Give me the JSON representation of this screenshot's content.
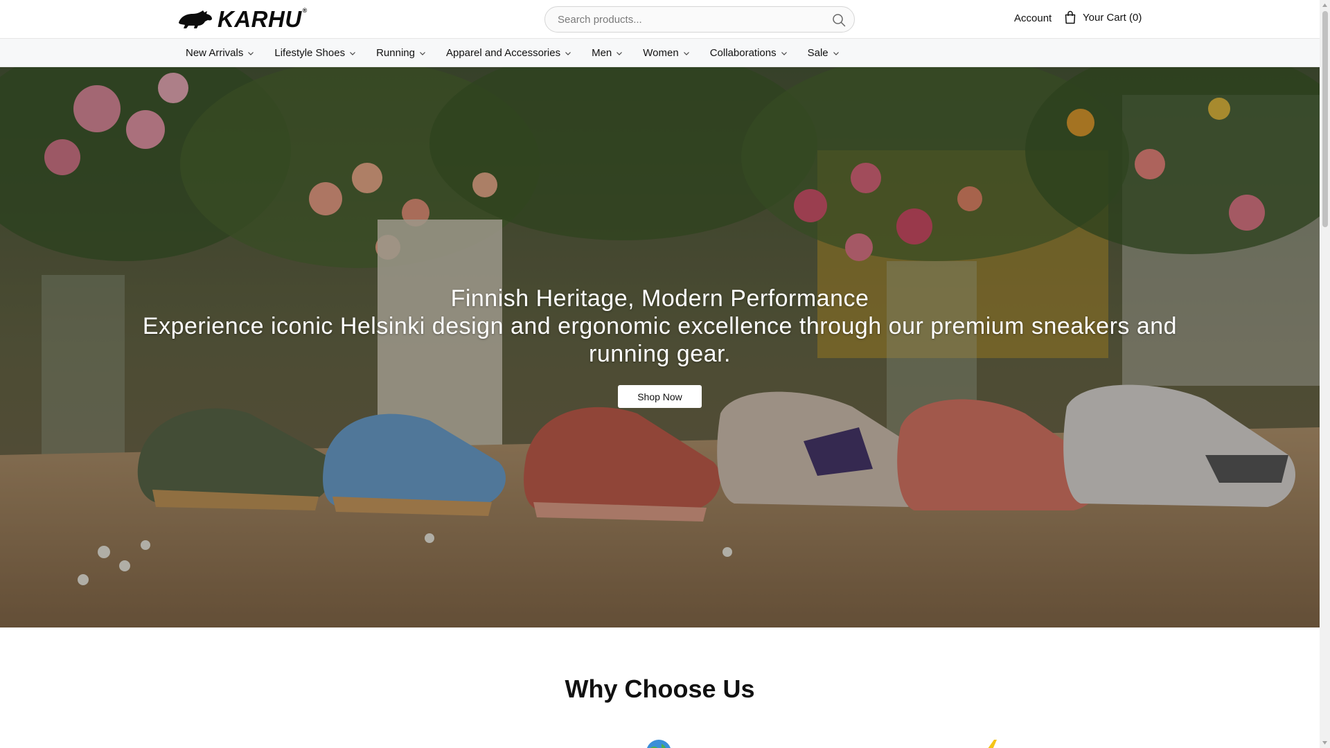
{
  "header": {
    "logo_text": "KARHU",
    "logo_reg": "®",
    "search_placeholder": "Search products...",
    "account_label": "Account",
    "cart_label": "Your Cart (0)"
  },
  "nav": {
    "items": [
      {
        "label": "New Arrivals"
      },
      {
        "label": "Lifestyle Shoes"
      },
      {
        "label": "Running"
      },
      {
        "label": "Apparel and Accessories"
      },
      {
        "label": "Men"
      },
      {
        "label": "Women"
      },
      {
        "label": "Collaborations"
      },
      {
        "label": "Sale"
      }
    ]
  },
  "hero": {
    "title": "Finnish Heritage, Modern Performance",
    "subtitle": "Experience iconic Helsinki design and ergonomic excellence through our premium sneakers and running gear.",
    "cta_label": "Shop Now"
  },
  "why": {
    "title": "Why Choose Us"
  },
  "icons": {
    "brand": "bear-logo-icon",
    "search": "search-icon",
    "cart": "shopping-bag-icon",
    "nav_chevron": "chevron-down-icon",
    "feature_1": "globe-icon",
    "feature_2": "lightning-bolt-icon"
  },
  "colors": {
    "text": "#111111",
    "nav_bg": "#f7f8f9",
    "hero_overlay": "rgba(0,0,0,0.28)",
    "button_bg": "#ffffff"
  }
}
